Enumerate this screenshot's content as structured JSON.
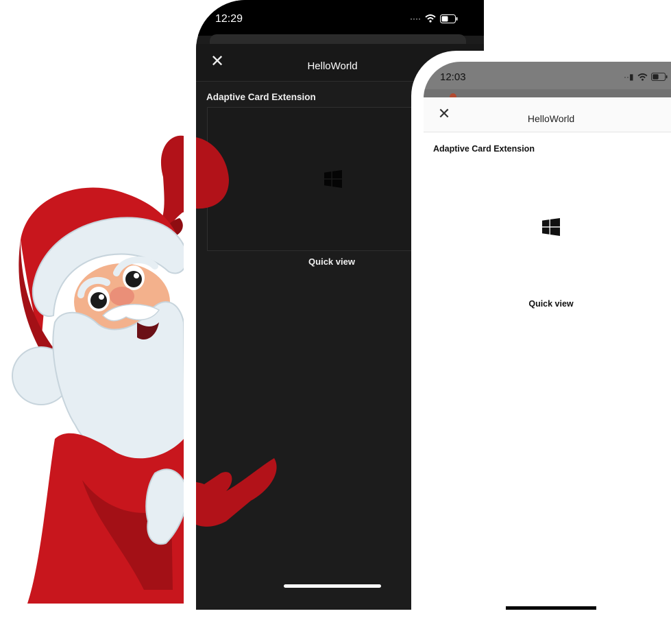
{
  "dark_phone": {
    "status_time": "12:29",
    "header_title": "HelloWorld",
    "section_title": "Adaptive Card Extension",
    "quick_view_label": "Quick view",
    "close_glyph": "✕"
  },
  "light_phone": {
    "status_time": "12:03",
    "header_title": "HelloWorld",
    "section_title": "Adaptive Card Extension",
    "quick_view_label": "Quick view",
    "close_glyph": "✕"
  },
  "icons": [
    "close-icon",
    "windows-logo-icon",
    "wifi-icon",
    "battery-icon",
    "signal-icon"
  ],
  "colors": {
    "dark_bg": "#1c1c1c",
    "light_status_bar": "#7d7d7d",
    "santa_red": "#c8161d",
    "santa_fur": "#e6eef3",
    "santa_skin": "#f3b18c"
  }
}
